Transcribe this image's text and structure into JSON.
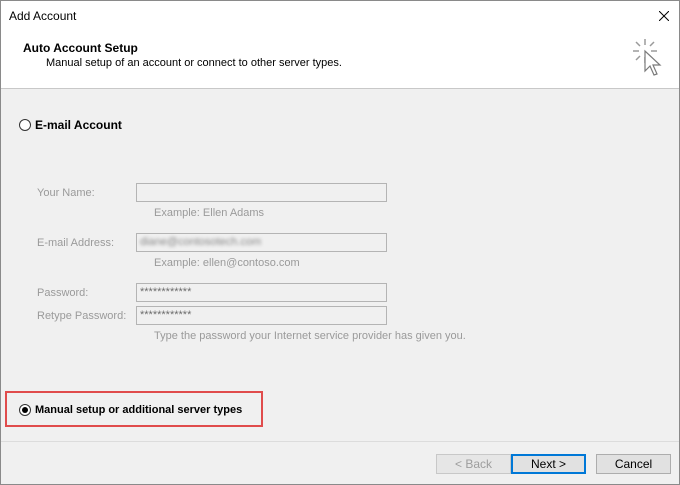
{
  "window": {
    "title": "Add Account"
  },
  "header": {
    "title": "Auto Account Setup",
    "subtitle": "Manual setup of an account or connect to other server types."
  },
  "email_account": {
    "label": "E-mail Account",
    "selected": false,
    "your_name": {
      "label": "Your Name:",
      "value": "",
      "hint": "Example: Ellen Adams"
    },
    "email_address": {
      "label": "E-mail Address:",
      "value": "diane@contosotech.com",
      "hint": "Example: ellen@contoso.com"
    },
    "password": {
      "label": "Password:",
      "value": "************"
    },
    "retype_password": {
      "label": "Retype Password:",
      "value": "************",
      "hint": "Type the password your Internet service provider has given you."
    }
  },
  "manual_setup": {
    "label": "Manual setup or additional server types",
    "selected": true
  },
  "buttons": {
    "back": "< Back",
    "next": "Next >",
    "cancel": "Cancel"
  },
  "colors": {
    "highlight": "#e04c4c",
    "primary_border": "#0078d7"
  }
}
